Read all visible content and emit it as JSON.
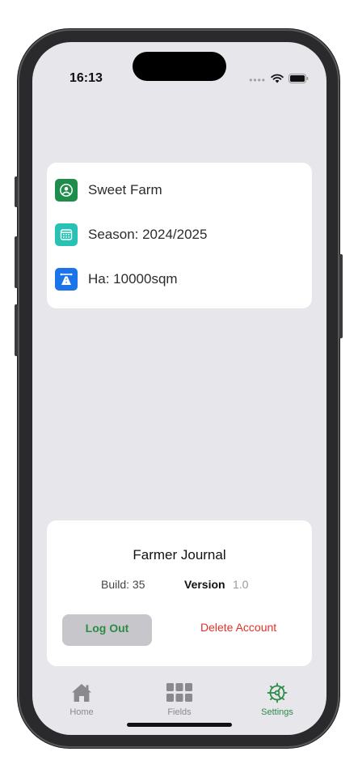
{
  "status_bar": {
    "time": "16:13",
    "signal_dots": "••••",
    "wifi_icon": "wifi-icon",
    "battery_icon": "battery-icon"
  },
  "farm": {
    "name": "Sweet Farm",
    "season": "Season: 2024/2025",
    "area": "Ha: 10000sqm",
    "icons": {
      "name": "person-circle-icon",
      "season": "calendar-icon",
      "area": "road-icon"
    },
    "colors": {
      "name_icon_bg": "#1e8c4a",
      "season_icon_bg": "#27c2b4",
      "area_icon_bg": "#1b74e8"
    }
  },
  "app_info": {
    "title": "Farmer Journal",
    "build": "Build: 35",
    "version_label": "Version",
    "version_value": "1.0",
    "logout_label": "Log Out",
    "delete_label": "Delete Account"
  },
  "tabs": [
    {
      "label": "Home",
      "icon": "house-icon",
      "active": false
    },
    {
      "label": "Fields",
      "icon": "grid-icon",
      "active": false
    },
    {
      "label": "Settings",
      "icon": "gear-icon",
      "active": true
    }
  ],
  "colors": {
    "accent": "#2c8b47",
    "danger": "#e0322b",
    "background": "#e6e6eb"
  }
}
